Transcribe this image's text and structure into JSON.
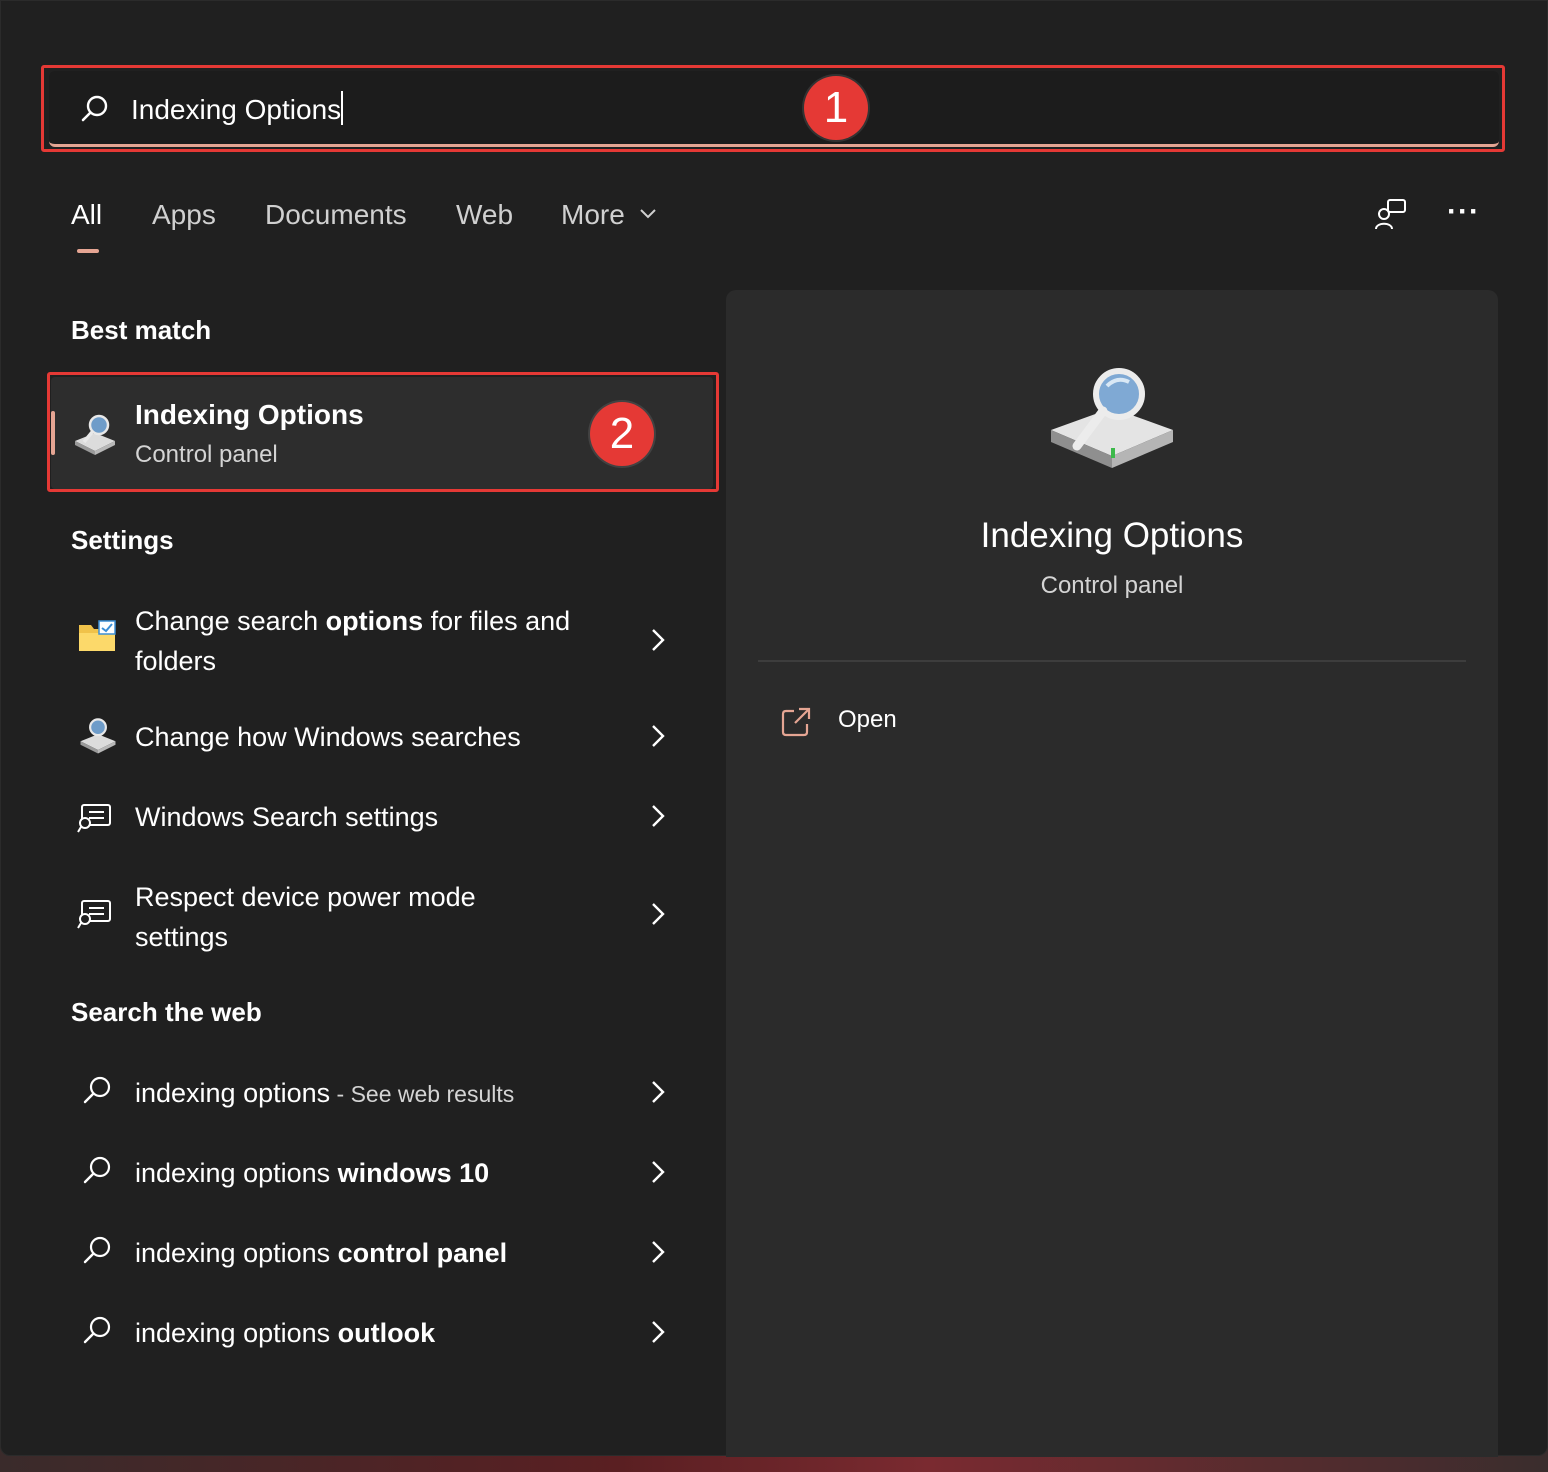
{
  "search": {
    "query": "Indexing Options",
    "icon": "search-icon"
  },
  "annotations": {
    "badge_1": "1",
    "badge_2": "2",
    "color": "#e53935"
  },
  "tabs": [
    {
      "label": "All",
      "active": true
    },
    {
      "label": "Apps"
    },
    {
      "label": "Documents"
    },
    {
      "label": "Web"
    },
    {
      "label": "More"
    }
  ],
  "toolbar": {
    "feedback_icon": "feedback-icon",
    "more_options_label": "···"
  },
  "best_match": {
    "heading": "Best match",
    "title": "Indexing Options",
    "subtitle": "Control panel",
    "icon": "indexing-options-icon"
  },
  "settings": {
    "heading": "Settings",
    "items": [
      {
        "pre": "Change search ",
        "bold": "options",
        "post": " for files and folders",
        "icon": "folder-options-icon"
      },
      {
        "pre": "Change how Windows searches",
        "bold": "",
        "post": "",
        "icon": "indexing-options-icon"
      },
      {
        "pre": "Windows Search settings",
        "bold": "",
        "post": "",
        "icon": "search-settings-icon"
      },
      {
        "pre": "Respect device power mode settings",
        "bold": "",
        "post": "",
        "icon": "search-settings-icon"
      }
    ]
  },
  "web": {
    "heading": "Search the web",
    "items": [
      {
        "pre": "indexing options",
        "bold": "",
        "suffix": " - See web results"
      },
      {
        "pre": "indexing options ",
        "bold": "windows 10",
        "suffix": ""
      },
      {
        "pre": "indexing options ",
        "bold": "control panel",
        "suffix": ""
      },
      {
        "pre": "indexing options ",
        "bold": "outlook",
        "suffix": ""
      }
    ]
  },
  "preview": {
    "title": "Indexing Options",
    "subtitle": "Control panel",
    "open_label": "Open",
    "accent": "#e5a593"
  }
}
